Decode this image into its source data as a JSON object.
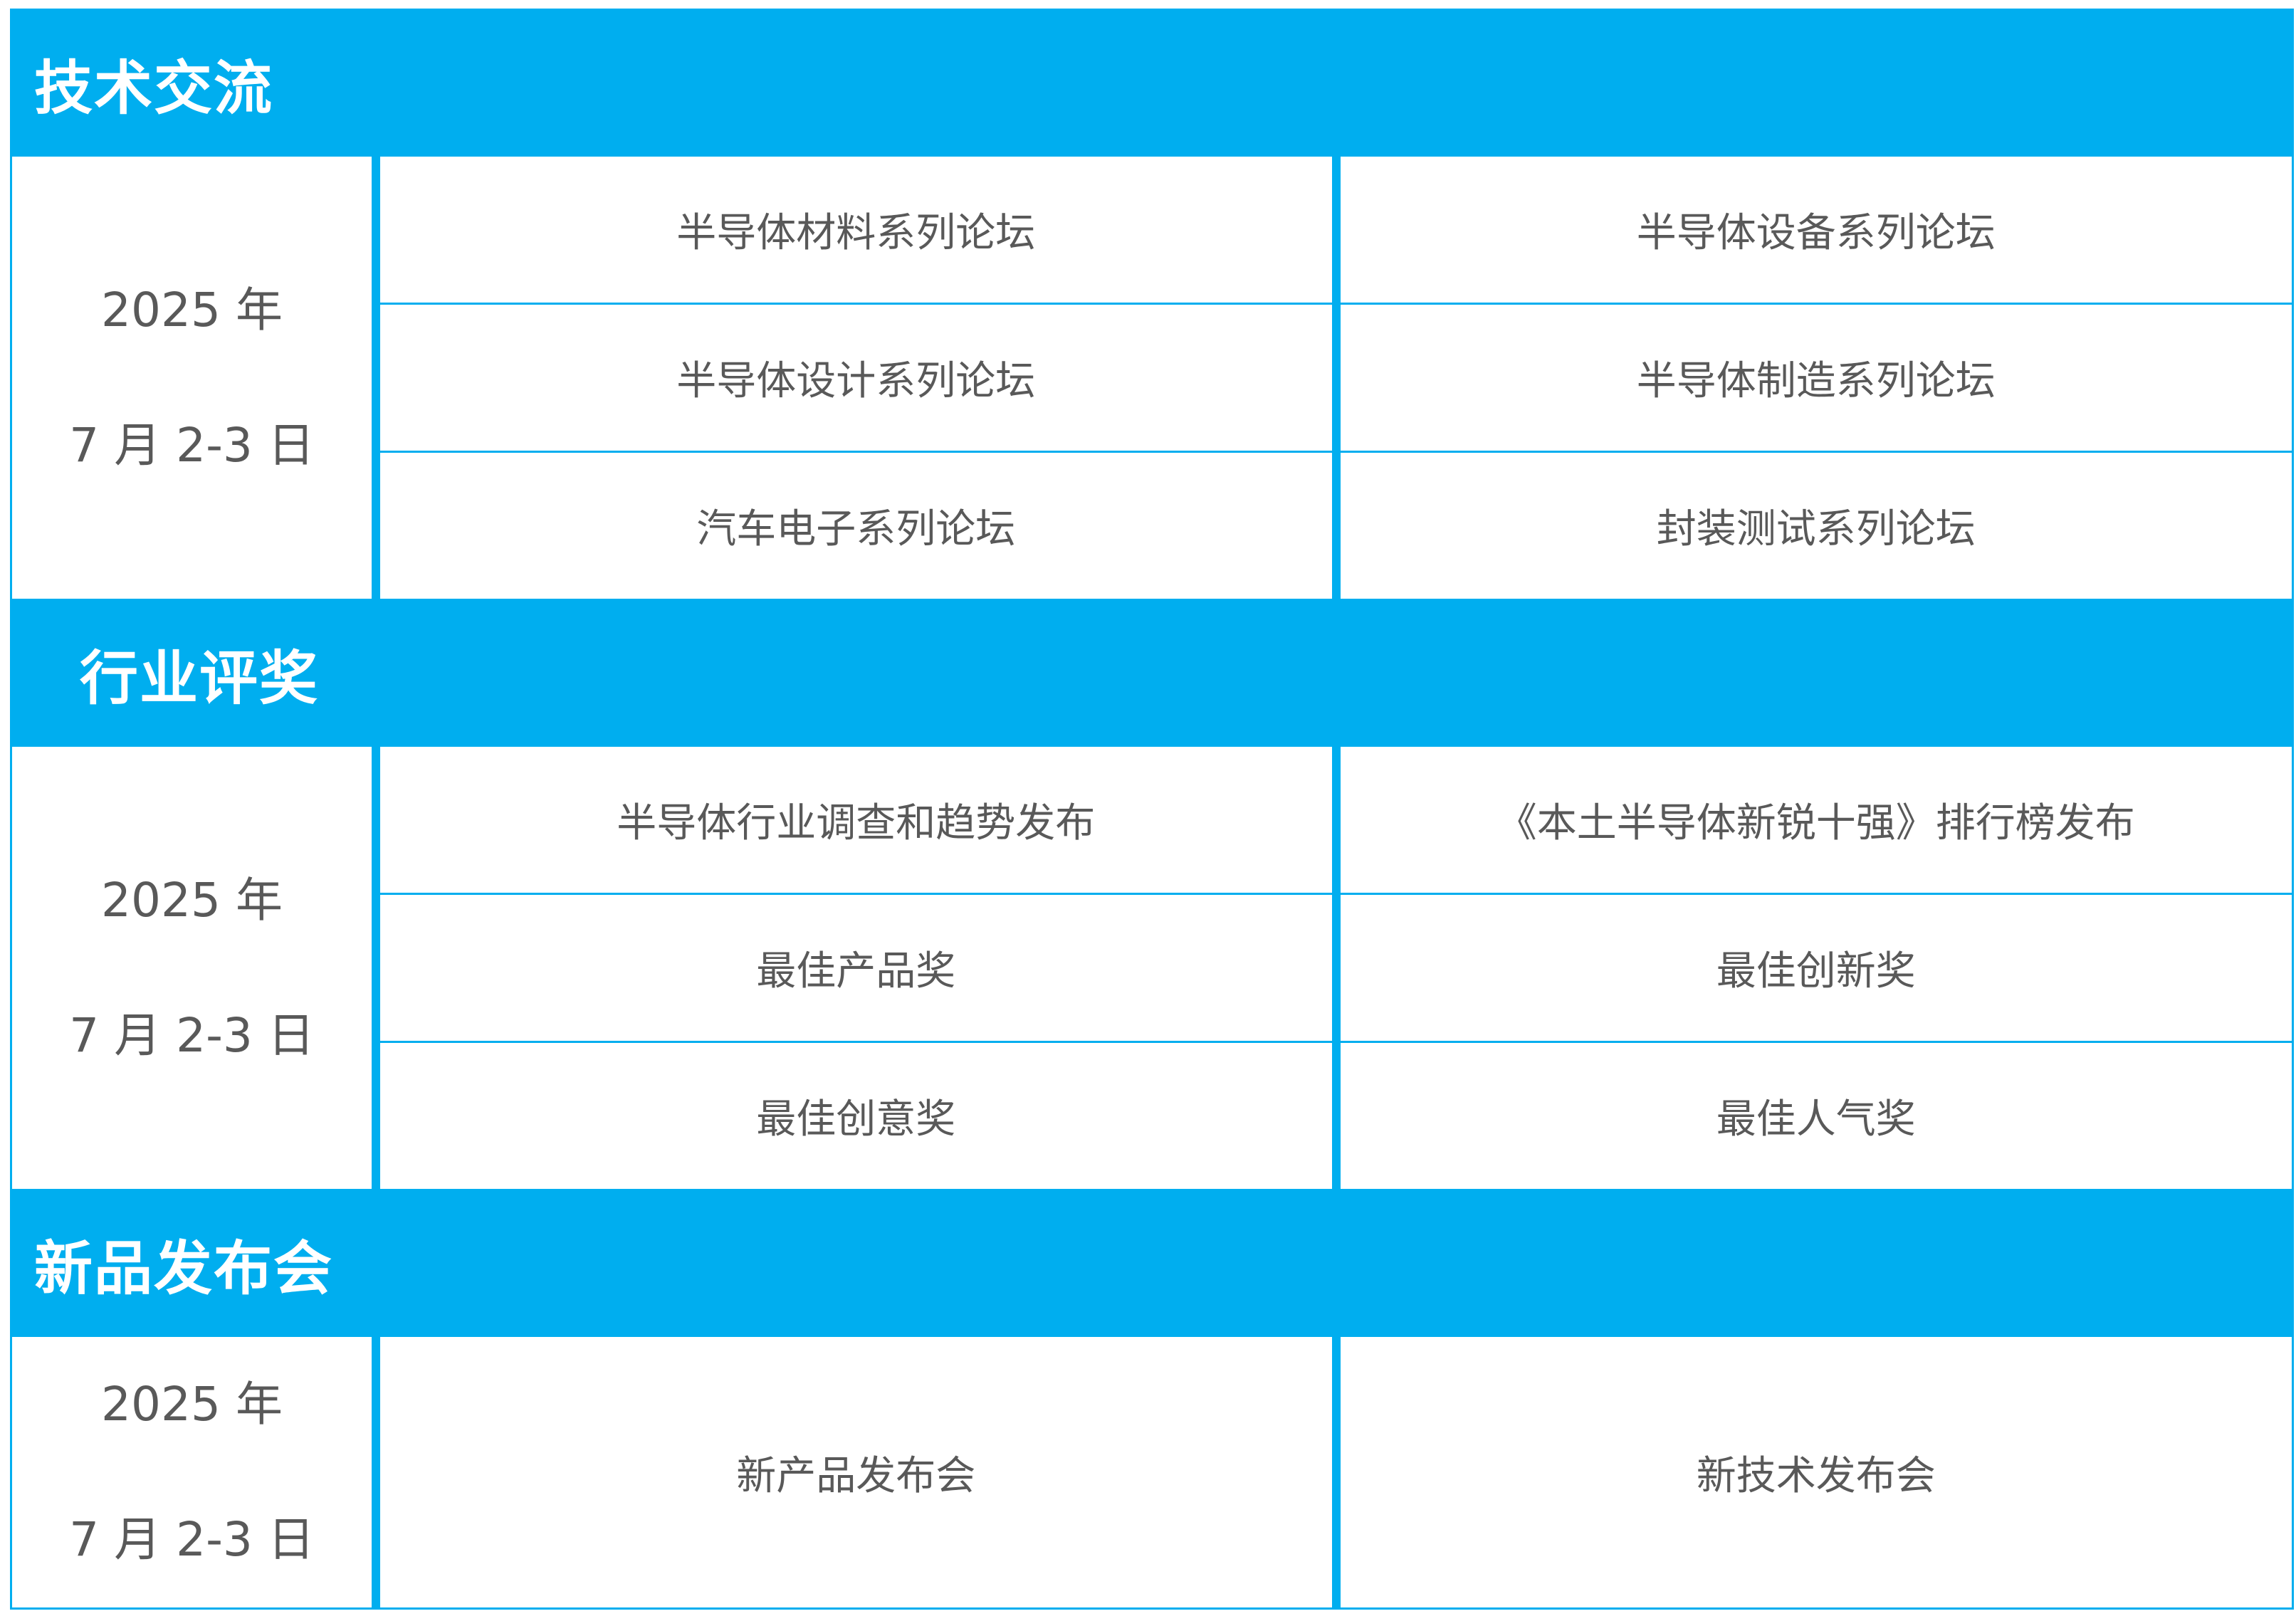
{
  "sections": [
    {
      "title": "技术交流",
      "date_line1": "2025 年",
      "date_line2": "7 月 2-3 日",
      "left": [
        "半导体材料系列论坛",
        "半导体设计系列论坛",
        "汽车电子系列论坛"
      ],
      "right": [
        "半导体设备系列论坛",
        "半导体制造系列论坛",
        "封装测试系列论坛"
      ]
    },
    {
      "title": "行业评奖",
      "date_line1": "2025 年",
      "date_line2": "7 月 2-3 日",
      "left": [
        "半导体行业调查和趋势发布",
        "最佳产品奖",
        "最佳创意奖"
      ],
      "right": [
        "《本土半导体新锐十强》排行榜发布",
        "最佳创新奖",
        "最佳人气奖"
      ]
    },
    {
      "title": "新品发布会",
      "date_line1": "2025 年",
      "date_line2": "7 月 2-3 日",
      "left": [
        "新产品发布会"
      ],
      "right": [
        "新技术发布会"
      ]
    }
  ],
  "colors": {
    "accent": "#00AEEF",
    "text": "#595959",
    "header_text": "#FFFFFF"
  }
}
